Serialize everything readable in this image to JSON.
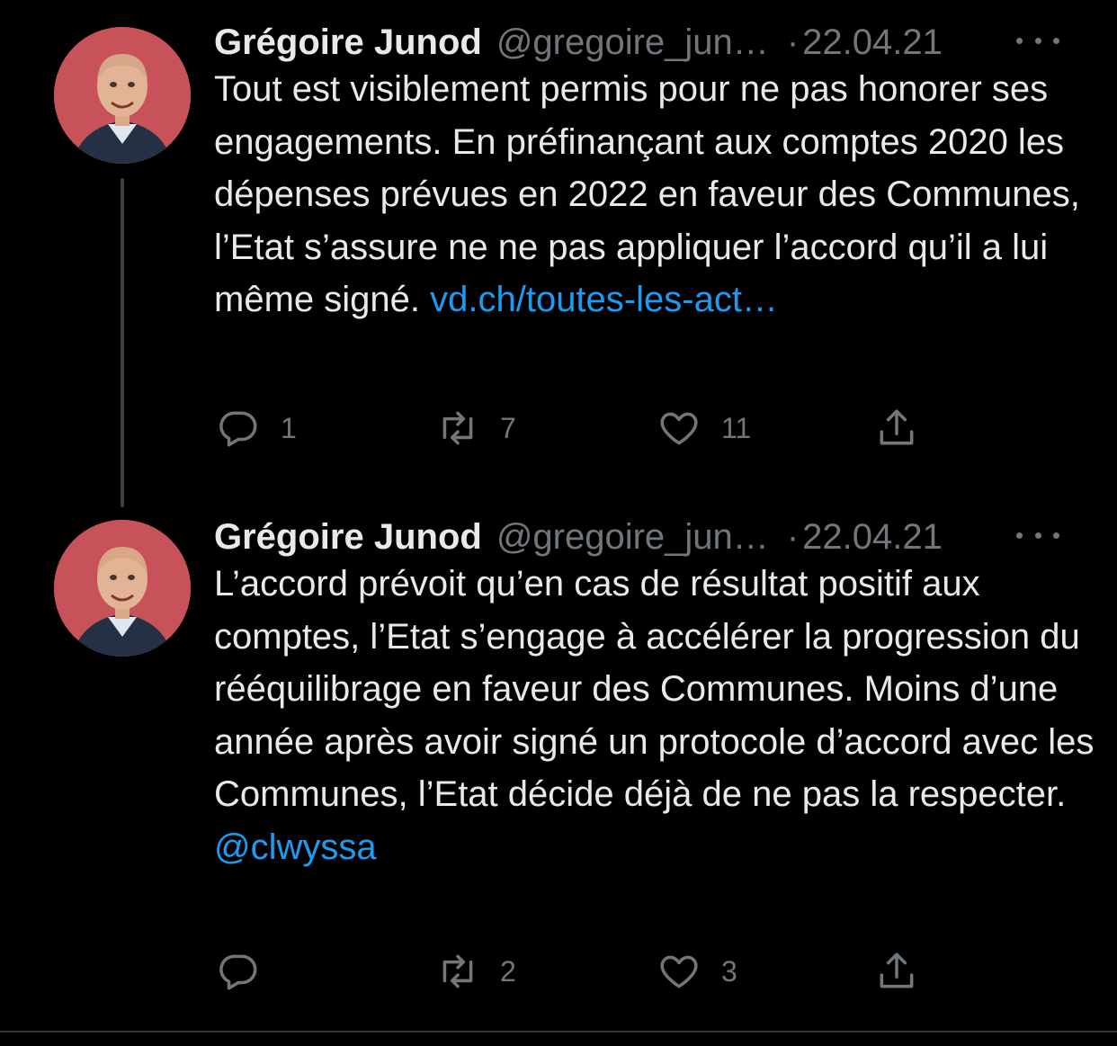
{
  "tweets": [
    {
      "author_name": "Grégoire Junod",
      "handle": "@gregoire_jun…",
      "dot": "·",
      "date": "22.04.21",
      "text": "Tout est visiblement permis pour ne pas honorer ses engagements. En préfinançant aux comptes 2020 les dépenses prévues en 2022 en faveur des Communes, l’Etat s’assure ne ne pas appliquer l’accord qu’il a lui même signé.",
      "link": "vd.ch/toutes-les-act…",
      "replies": "1",
      "retweets": "7",
      "likes": "11"
    },
    {
      "author_name": "Grégoire Junod",
      "handle": "@gregoire_jun…",
      "dot": "·",
      "date": "22.04.21",
      "text": "L’accord prévoit qu’en cas de résultat positif aux comptes, l’Etat s’engage à accélérer la progression du rééquilibrage en faveur des Communes. Moins d’une année après avoir signé un protocole d’accord avec les Communes, l’Etat décide déjà de ne pas la respecter.",
      "link": "@clwyssa",
      "replies": "",
      "retweets": "2",
      "likes": "3"
    }
  ],
  "colors": {
    "background": "#000000",
    "text": "#e7e9ea",
    "muted": "#71767b",
    "link": "#1d9bf0",
    "avatar_bg": "#c8525a"
  },
  "icons": [
    "reply-icon",
    "retweet-icon",
    "like-icon",
    "share-icon",
    "more-icon"
  ]
}
